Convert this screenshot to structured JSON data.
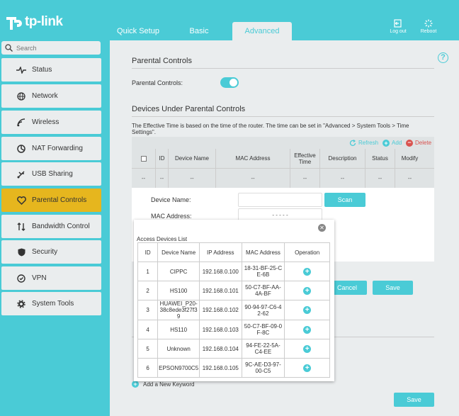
{
  "brand": {
    "name": "tp-link"
  },
  "tabs": [
    {
      "label": "Quick Setup"
    },
    {
      "label": "Basic"
    },
    {
      "label": "Advanced"
    }
  ],
  "header_actions": {
    "logout": "Log out",
    "reboot": "Reboot"
  },
  "search": {
    "placeholder": "Search"
  },
  "sidebar": {
    "items": [
      {
        "label": "Status",
        "icon": "status-pulse-icon"
      },
      {
        "label": "Network",
        "icon": "globe-icon"
      },
      {
        "label": "Wireless",
        "icon": "wifi-icon"
      },
      {
        "label": "NAT Forwarding",
        "icon": "nat-icon"
      },
      {
        "label": "USB Sharing",
        "icon": "usb-icon"
      },
      {
        "label": "Parental Controls",
        "icon": "heart-icon",
        "active": true
      },
      {
        "label": "Bandwidth Control",
        "icon": "bandwidth-arrows-icon"
      },
      {
        "label": "Security",
        "icon": "shield-icon"
      },
      {
        "label": "VPN",
        "icon": "vpn-icon"
      },
      {
        "label": "System Tools",
        "icon": "gear-icon"
      }
    ]
  },
  "parental": {
    "section_title": "Parental Controls",
    "toggle_label": "Parental Controls:",
    "toggle_on": true,
    "devices_title": "Devices Under Parental Controls",
    "effective_note": "The Effective Time is based on the time of the router. The time can be set in \"Advanced > System Tools > Time Settings\".",
    "actions": {
      "refresh": "Refresh",
      "add": "Add",
      "delete": "Delete"
    },
    "columns": [
      "ID",
      "Device Name",
      "MAC Address",
      "Effective Time",
      "Description",
      "Status",
      "Modify"
    ],
    "empty_row": [
      "--",
      "--",
      "--",
      "--",
      "--",
      "--",
      "--",
      "--"
    ],
    "form": {
      "device_name_label": "Device Name:",
      "mac_label": "MAC Address:",
      "mac_placeholder": "-  -  -  -  -",
      "scan": "Scan",
      "cancel": "Cancel",
      "save": "Save"
    },
    "add_keyword": "Add a New Keyword",
    "bottom_save": "Save"
  },
  "popup": {
    "title": "Access Devices List",
    "columns": [
      "ID",
      "Device Name",
      "IP Address",
      "MAC Address",
      "Operation"
    ],
    "rows": [
      {
        "id": "1",
        "name": "CIPPC",
        "ip": "192.168.0.100",
        "mac": "18-31-BF-25-CE-6B"
      },
      {
        "id": "2",
        "name": "HS100",
        "ip": "192.168.0.101",
        "mac": "50-C7-BF-AA-4A-BF"
      },
      {
        "id": "3",
        "name": "HUAWEI_P20-38c8ede3f27f39",
        "ip": "192.168.0.102",
        "mac": "90-94-97-C6-42-62"
      },
      {
        "id": "4",
        "name": "HS110",
        "ip": "192.168.0.103",
        "mac": "50-C7-BF-09-0F-8C"
      },
      {
        "id": "5",
        "name": "Unknown",
        "ip": "192.168.0.104",
        "mac": "94-FE-22-5A-C4-EE"
      },
      {
        "id": "6",
        "name": "EPSON9700C5",
        "ip": "192.168.0.105",
        "mac": "9C-AE-D3-97-00-C5"
      }
    ]
  },
  "colors": {
    "accent": "#4acbd6",
    "active_nav": "#e6b61e",
    "panel_bg": "#eaedee",
    "delete_red": "#d9534f"
  }
}
